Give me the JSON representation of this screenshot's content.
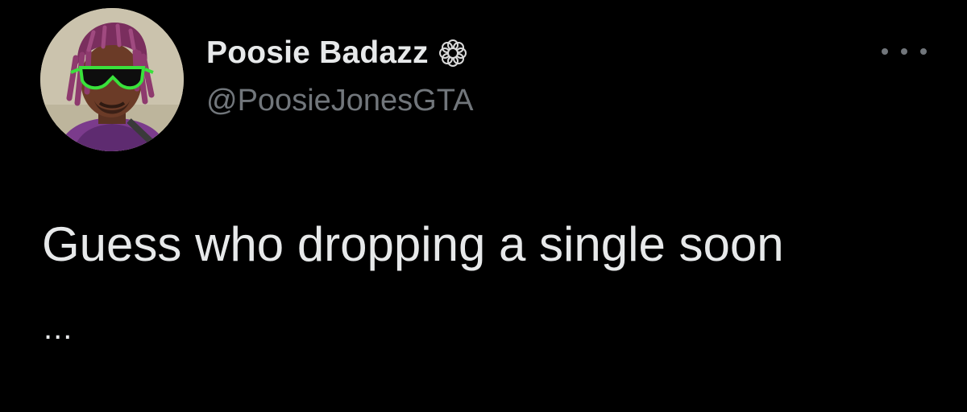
{
  "tweet": {
    "display_name": "Poosie Badazz",
    "handle": "@PoosieJonesGTA",
    "text": "Guess who dropping a single soon",
    "ellipsis": "...",
    "name_badge_icon": "flower-icon",
    "more_icon": "more-options-icon"
  },
  "colors": {
    "background": "#000000",
    "primary_text": "#e7e9ea",
    "secondary_text": "#71767b"
  }
}
